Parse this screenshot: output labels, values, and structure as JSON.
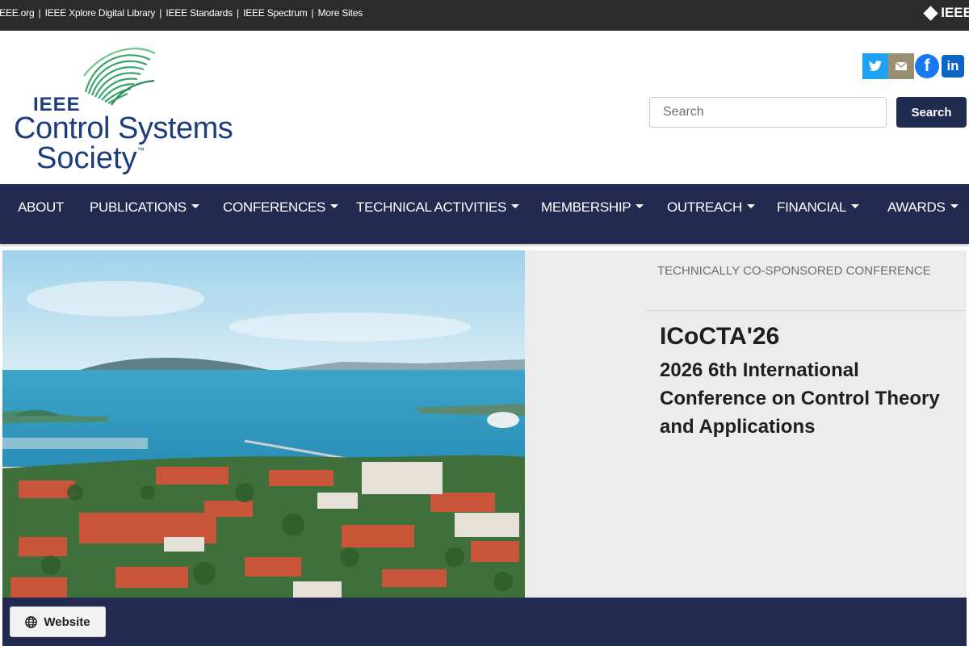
{
  "metabar": {
    "links": [
      "IEEE.org",
      "IEEE Xplore Digital Library",
      "IEEE Standards",
      "IEEE Spectrum",
      "More Sites"
    ],
    "brand": "IEEE"
  },
  "logo": {
    "line1": "IEEE",
    "line2": "Control Systems",
    "line3": "Society",
    "tm": "™"
  },
  "social": {
    "icons": [
      "twitter-icon",
      "email-icon",
      "facebook-icon",
      "linkedin-icon"
    ]
  },
  "search": {
    "placeholder": "Search",
    "button_label": "Search"
  },
  "nav": {
    "items": [
      {
        "label": "ABOUT",
        "dropdown": false
      },
      {
        "label": "PUBLICATIONS",
        "dropdown": true
      },
      {
        "label": "CONFERENCES",
        "dropdown": true
      },
      {
        "label": "TECHNICAL ACTIVITIES",
        "dropdown": true
      },
      {
        "label": "MEMBERSHIP",
        "dropdown": true
      },
      {
        "label": "OUTREACH",
        "dropdown": true
      },
      {
        "label": "FINANCIAL",
        "dropdown": true
      },
      {
        "label": "AWARDS",
        "dropdown": true
      }
    ]
  },
  "feature": {
    "badge": "TECHNICALLY CO-SPONSORED CONFERENCE",
    "acronym": "ICoCTA'26",
    "title": "2026 6th International Conference on Control Theory and Applications",
    "website_label": "Website"
  },
  "colors": {
    "navy": "#232a50",
    "metabar": "#2b2b2b",
    "logo_blue": "#1d3d7a",
    "logo_green": "#3aa56a"
  }
}
